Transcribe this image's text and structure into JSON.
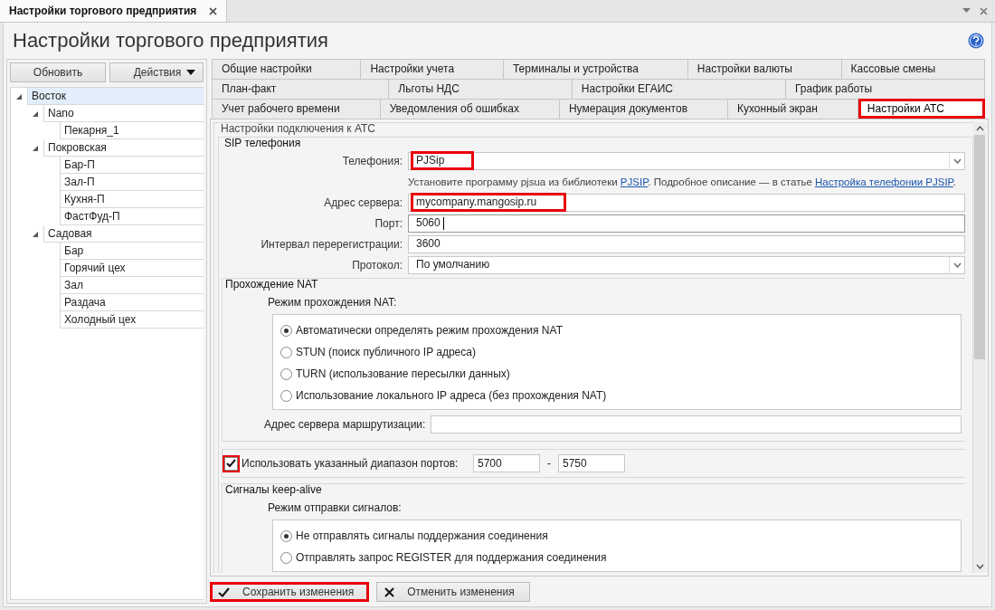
{
  "document_tab": {
    "title": "Настройки торгового предприятия",
    "selected": true
  },
  "title": "Настройки торгового предприятия",
  "left_panel": {
    "buttons": [
      {
        "label": "Обновить",
        "kind": "plain"
      },
      {
        "label": "Действия",
        "kind": "dropdown"
      }
    ],
    "tree": [
      {
        "label": "Восток",
        "selected": true,
        "expanded": true,
        "children": [
          {
            "label": "Nano",
            "selected": false,
            "expanded": true,
            "children": [
              {
                "label": "Пекарня_1",
                "selected": false
              }
            ]
          },
          {
            "label": "Покровская",
            "selected": false,
            "expanded": true,
            "children": [
              {
                "label": "Бар-П",
                "selected": false
              },
              {
                "label": "Зал-П",
                "selected": false
              },
              {
                "label": "Кухня-П",
                "selected": false
              },
              {
                "label": "ФастФуд-П",
                "selected": false
              }
            ]
          },
          {
            "label": "Садовая",
            "selected": false,
            "expanded": true,
            "children": [
              {
                "label": "Бар",
                "selected": false
              },
              {
                "label": "Горячий цех",
                "selected": false
              },
              {
                "label": "Зал",
                "selected": false
              },
              {
                "label": "Раздача",
                "selected": false
              },
              {
                "label": "Холодный цех",
                "selected": false
              }
            ]
          }
        ]
      }
    ]
  },
  "tab_rows": [
    {
      "tabs": [
        {
          "label": "Общие настройки",
          "selected": false,
          "highlighted": false
        },
        {
          "label": "Настройки учета",
          "selected": false,
          "highlighted": false
        },
        {
          "label": "Терминалы и устройства",
          "selected": false,
          "highlighted": false
        },
        {
          "label": "Настройки валюты",
          "selected": false,
          "highlighted": false
        },
        {
          "label": "Кассовые смены",
          "selected": false,
          "highlighted": false
        }
      ]
    },
    {
      "tabs": [
        {
          "label": "План-факт",
          "selected": false,
          "highlighted": false
        },
        {
          "label": "Льготы НДС",
          "selected": false,
          "highlighted": false
        },
        {
          "label": "Настройки ЕГАИС",
          "selected": false,
          "highlighted": false
        },
        {
          "label": "График работы",
          "selected": false,
          "highlighted": false
        }
      ]
    },
    {
      "tabs": [
        {
          "label": "Учет рабочего времени",
          "selected": false,
          "highlighted": false
        },
        {
          "label": "Уведомления об ошибках",
          "selected": false,
          "highlighted": false
        },
        {
          "label": "Нумерация документов",
          "selected": false,
          "highlighted": false
        },
        {
          "label": "Кухонный экран",
          "selected": false,
          "highlighted": false
        },
        {
          "label": "Настройки АТС",
          "selected": true,
          "highlighted": true
        }
      ]
    }
  ],
  "settings": {
    "legend": "Настройки подключения к АТС",
    "sip": {
      "legend": "SIP телефония",
      "fields": [
        {
          "kind": "dropdown",
          "label": "Телефония:",
          "value": "PJSip",
          "highlighted": true
        },
        {
          "kind": "hint",
          "parts": [
            {
              "text": "Установите программу pjsua из библиотеки ",
              "link": false
            },
            {
              "text": "PJSIP",
              "link": true
            },
            {
              "text": ". Подробное описание — в статье ",
              "link": false
            },
            {
              "text": "Настройка телефонии PJSIP",
              "link": true
            },
            {
              "text": ".",
              "link": false
            }
          ]
        },
        {
          "kind": "text",
          "label": "Адрес сервера:",
          "value": "mycompany.mangosip.ru",
          "highlighted": true,
          "focused": false
        },
        {
          "kind": "text",
          "label": "Порт:",
          "value": "5060",
          "highlighted": false,
          "focused": true
        },
        {
          "kind": "text",
          "label": "Интервал перерегистрации:",
          "value": "3600",
          "highlighted": false,
          "focused": false
        },
        {
          "kind": "dropdown",
          "label": "Протокол:",
          "value": "По умолчанию",
          "highlighted": false
        }
      ]
    },
    "nat": {
      "legend": "Прохождение NAT",
      "mode_label": "Режим прохождения NAT:",
      "options": [
        {
          "label": "Автоматически определять режим прохождения NAT",
          "selected": true
        },
        {
          "label": "STUN (поиск публичного IP адреса)",
          "selected": false
        },
        {
          "label": "TURN (использование пересылки данных)",
          "selected": false
        },
        {
          "label": "Использование локального IP адреса (без прохождения NAT)",
          "selected": false
        }
      ],
      "routing_label": "Адрес сервера маршрутизации:"
    },
    "port_range": {
      "label": "Использовать указанный диапазон портов:",
      "checked": true,
      "highlighted": true,
      "from": "5700",
      "separator": "-",
      "to": "5750"
    },
    "keepalive": {
      "legend": "Сигналы keep-alive",
      "mode_label": "Режим отправки сигналов:",
      "options": [
        {
          "label": "Не отправлять сигналы поддержания соединения",
          "selected": true
        },
        {
          "label": "Отправлять запрос REGISTER для поддержания соединения",
          "selected": false
        }
      ]
    }
  },
  "footer_buttons": [
    {
      "label": "Сохранить изменения",
      "kind": "save",
      "highlighted": true
    },
    {
      "label": "Отменить изменения",
      "kind": "cancel",
      "highlighted": false
    }
  ]
}
